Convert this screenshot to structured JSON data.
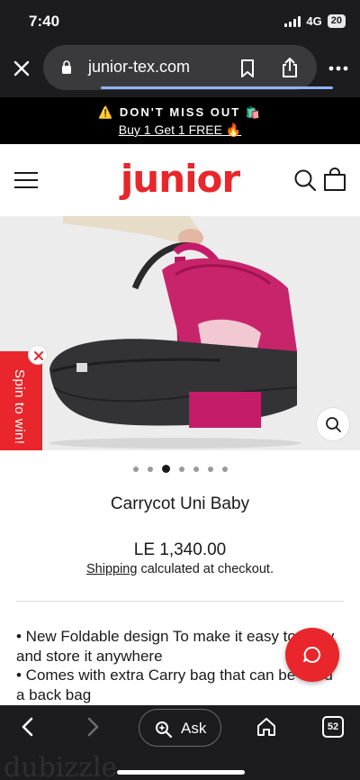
{
  "status": {
    "time": "7:40",
    "network": "4G",
    "battery": "20"
  },
  "browser": {
    "url": "junior-tex.com",
    "tabs_count": "52",
    "ask_label": "Ask"
  },
  "promo": {
    "line1": "⚠️ DON'T MISS OUT 🛍️",
    "line2": "Buy 1 Get 1 FREE 🔥"
  },
  "brand": {
    "logo": "junior",
    "color": "#e8262b"
  },
  "spin": {
    "label": "Spin to win!"
  },
  "carousel": {
    "total_dots": 7,
    "active_index": 2
  },
  "product": {
    "title": "Carrycot Uni Baby",
    "price": "LE 1,340.00",
    "shipping_link": "Shipping",
    "shipping_rest": " calculated at checkout.",
    "description_1": "• New Foldable design To make it easy to carry and store it anywhere",
    "description_2": "• Comes with extra Carry bag that can be used a back bag"
  },
  "watermark": "dubizzle"
}
